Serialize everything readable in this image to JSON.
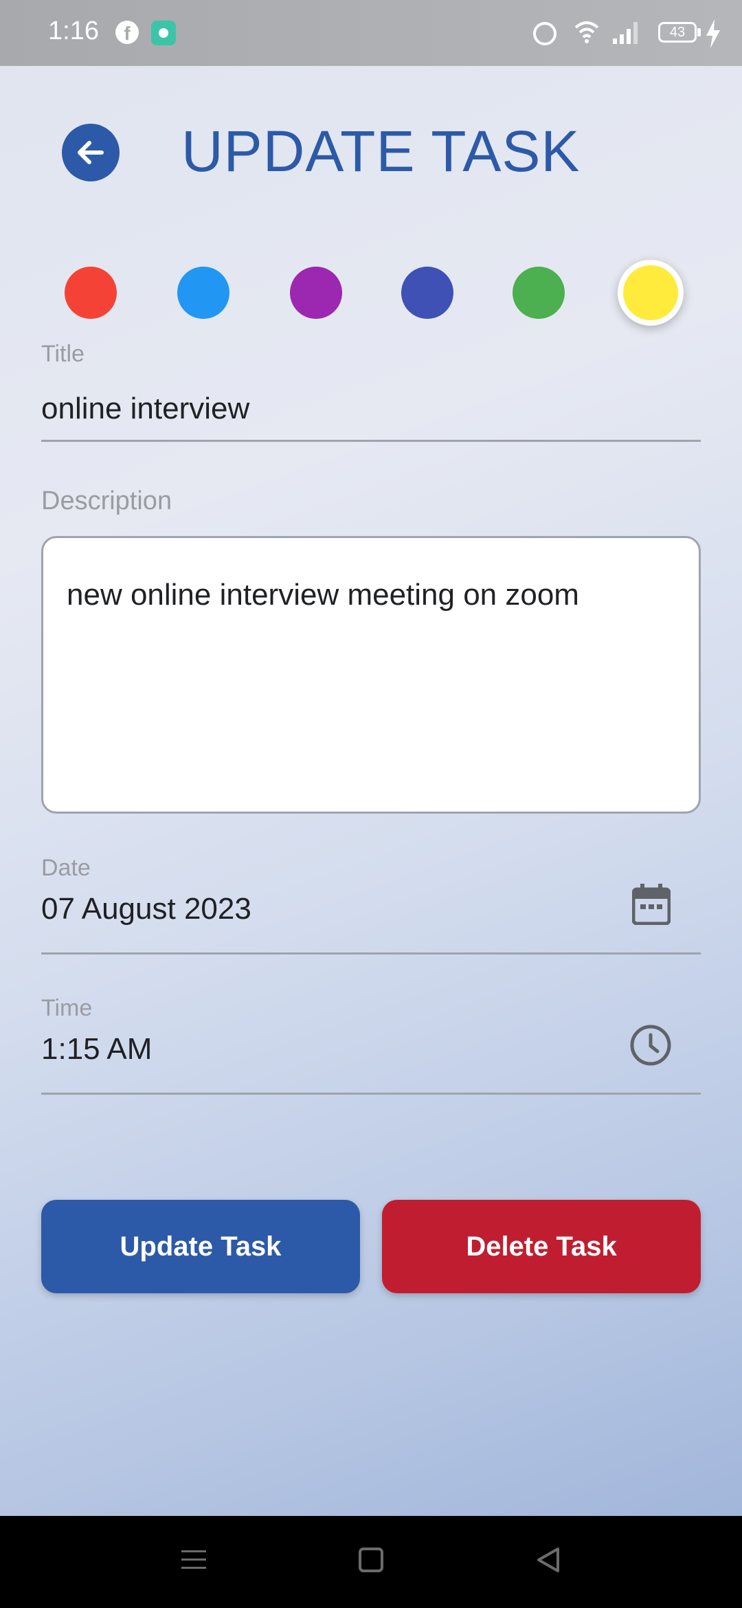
{
  "status_bar": {
    "time": "1:16",
    "battery": "43",
    "icons": [
      "facebook-icon",
      "app-icon",
      "alarm-icon",
      "wifi-icon",
      "signal-icon",
      "battery-icon",
      "charging-icon"
    ]
  },
  "header": {
    "title": "UPDATE TASK",
    "back_icon": "arrow-left-icon"
  },
  "colors": {
    "options": [
      "#f44336",
      "#2196f3",
      "#9c27b0",
      "#3f51b5",
      "#4caf50",
      "#ffeb3b"
    ],
    "selected": "#ffeb3b"
  },
  "form": {
    "title_label": "Title",
    "title_value": "online interview",
    "description_label": "Description",
    "description_value": "new online interview meeting on zoom",
    "date_label": "Date",
    "date_value": "07 August 2023",
    "time_label": "Time",
    "time_value": "1:15 AM"
  },
  "actions": {
    "update_label": "Update Task",
    "delete_label": "Delete Task",
    "update_color": "#2c5aa8",
    "delete_color": "#c01e30"
  },
  "nav": {
    "icons": [
      "menu-icon",
      "home-icon",
      "back-icon"
    ]
  }
}
